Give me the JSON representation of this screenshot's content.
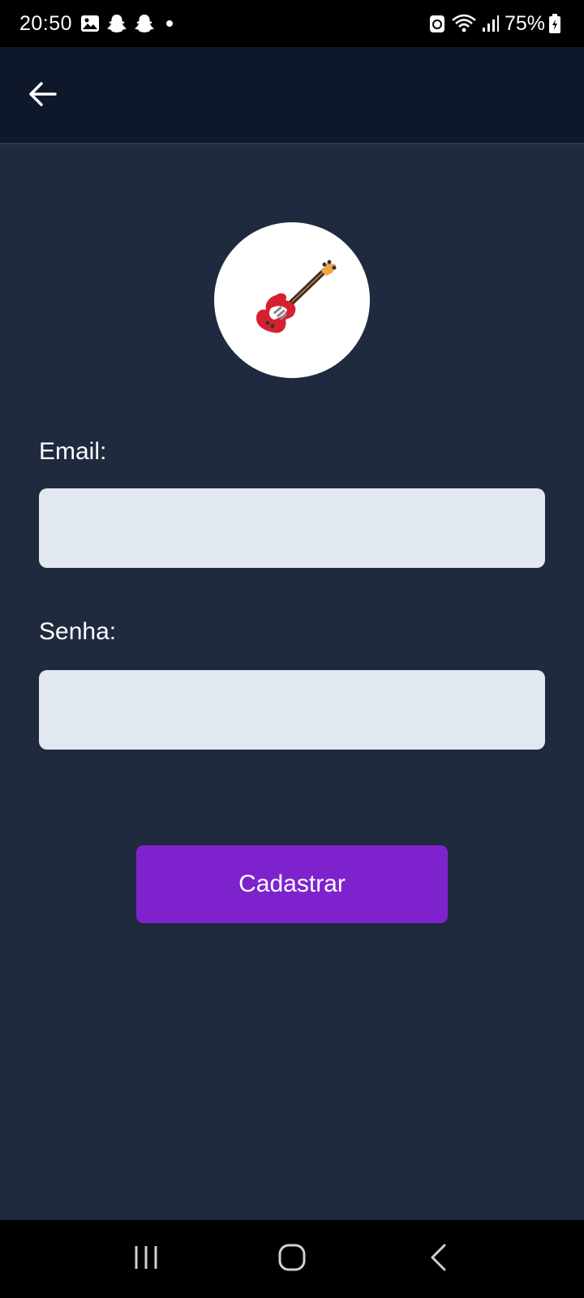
{
  "status_bar": {
    "time": "20:50",
    "battery": "75%",
    "left_icons": [
      "gallery-icon",
      "snapchat-icon",
      "snapchat-icon",
      "dot-icon"
    ],
    "right_icons": [
      "data-saver-icon",
      "wifi-icon",
      "signal-icon",
      "battery-icon"
    ]
  },
  "app_bar": {
    "back_icon": "arrow-left-icon"
  },
  "logo": {
    "icon": "guitar-icon"
  },
  "form": {
    "email_label": "Email:",
    "email_value": "",
    "password_label": "Senha:",
    "password_value": "",
    "submit_label": "Cadastrar"
  },
  "nav_bar": {
    "icons": [
      "recents-icon",
      "home-icon",
      "back-icon"
    ]
  },
  "colors": {
    "background": "#1f2a3e",
    "app_bar": "#0f172a",
    "input": "#e2e8f0",
    "button": "#7e22ce"
  }
}
